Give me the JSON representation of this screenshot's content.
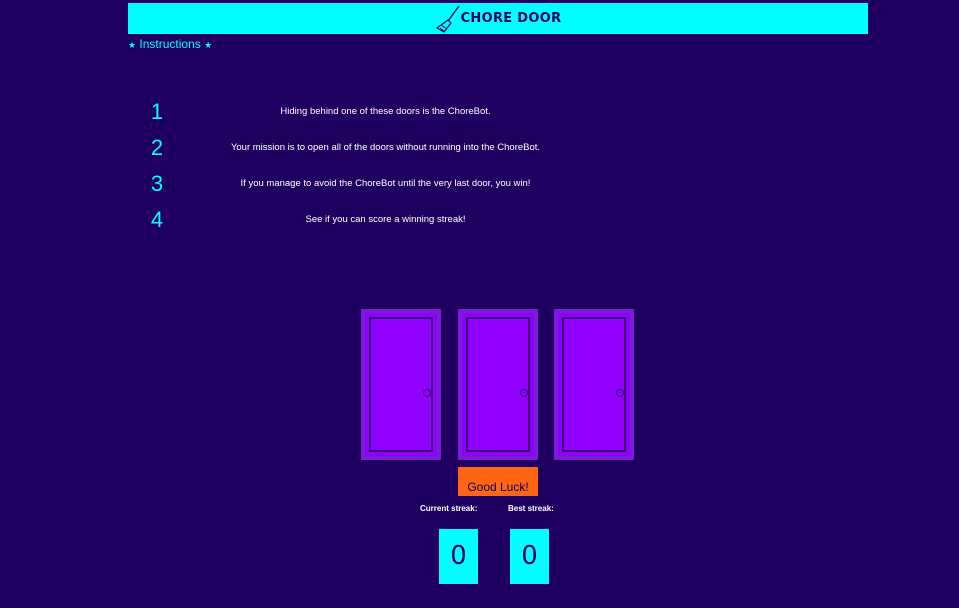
{
  "header": {
    "title": "CHORE DOOR",
    "icon": "broom-icon"
  },
  "instructions": {
    "toggle_label": "Instructions",
    "star": "★",
    "steps": [
      {
        "number": "1",
        "text": "Hiding behind one of these doors is the ChoreBot."
      },
      {
        "number": "2",
        "text": "Your mission is to open all of the doors without running into the ChoreBot."
      },
      {
        "number": "3",
        "text": "If you manage to avoid the ChoreBot until the very last door, you win!"
      },
      {
        "number": "4",
        "text": "See if you can score a winning streak!"
      }
    ]
  },
  "game": {
    "start_label": "Good Luck!",
    "current_streak_label": "Current streak:",
    "best_streak_label": "Best streak:",
    "current_streak": "0",
    "best_streak": "0"
  },
  "colors": {
    "background": "#1f0061",
    "accent": "#00ffff",
    "door": "#9000ff",
    "button": "#ff6512"
  }
}
